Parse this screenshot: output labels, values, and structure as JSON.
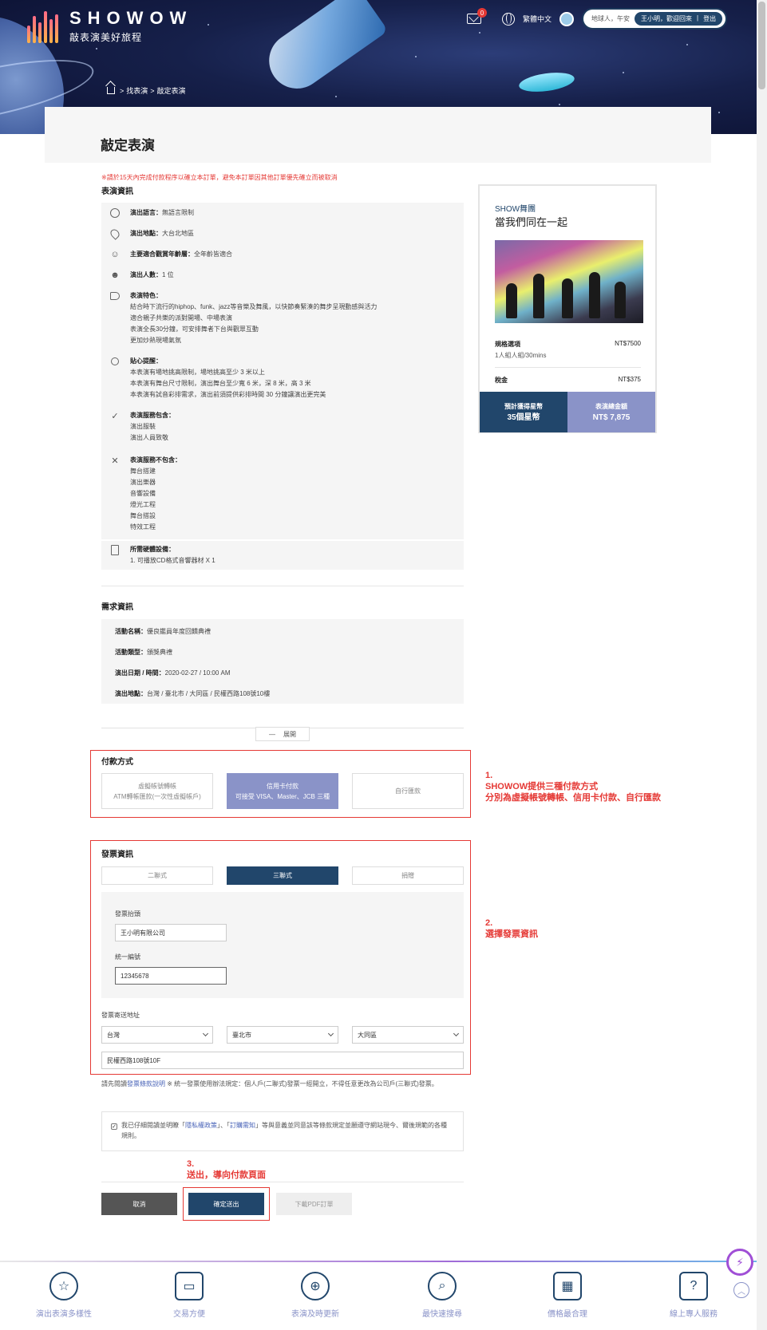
{
  "header": {
    "brand": "SHOWOW",
    "slogan": "敲表演美好旅程",
    "mail_count": "0",
    "language": "繁體中文",
    "greeting": "地球人，午安",
    "user_name": "王小明",
    "welcome": "，歡迎回來",
    "logout": "登出",
    "breadcrumb": [
      "找表演",
      "敲定表演"
    ]
  },
  "page": {
    "title": "敲定表演"
  },
  "notice": "※請於15天內完成付款程序以確立本訂單，避免本訂單因其他訂單優先確立而被取消",
  "show_info": {
    "title": "表演資訊",
    "rows": [
      {
        "icon": "globe-icon",
        "label": "演出語言：",
        "lines": [
          "無語言限制"
        ]
      },
      {
        "icon": "location-pin-icon",
        "label": "演出地點：",
        "lines": [
          "大台北地區"
        ]
      },
      {
        "icon": "audience-icon",
        "label": "主要適合觀賞年齡層：",
        "lines": [
          "全年齡皆適合"
        ]
      },
      {
        "icon": "performers-icon",
        "label": "演出人數：",
        "lines": [
          "1 位"
        ]
      },
      {
        "icon": "tag-icon",
        "label": "表演特色：",
        "lines": [
          "結合時下流行的hiphop、funk、jazz等音樂及舞風，以快節奏緊湊的舞步呈現動感與活力",
          "適合親子共樂的派對開場、中場表演",
          "表演全長30分鐘，可安排舞者下台與觀眾互動",
          "更加炒熱現場氣氛"
        ]
      },
      {
        "icon": "bulb-icon",
        "label": "貼心提醒：",
        "lines": [
          "本表演有場地挑高限制，場地挑高至少 3 米以上",
          "本表演有舞台尺寸限制，演出舞台至少寬 6 米，深 8 米，高 3 米",
          "本表演有試音彩排需求，演出前須提供彩排時間 30 分鐘讓演出更完美"
        ]
      },
      {
        "icon": "check-icon",
        "label": "表演服務包含：",
        "lines": [
          "演出服裝",
          "演出人員致敬"
        ]
      },
      {
        "icon": "cross-icon",
        "label": "表演服務不包含：",
        "lines": [
          "舞台搭建",
          "演出樂器",
          "音響設備",
          "燈光工程",
          "舞台搭設",
          "特效工程"
        ]
      },
      {
        "icon": "speaker-icon",
        "label": "所需硬體設備：",
        "lines": [
          "1. 可播放CD格式音響器材 X 1"
        ]
      }
    ]
  },
  "request_info": {
    "title": "需求資訊",
    "rows": [
      {
        "label": "活動名稱：",
        "value": "優良鑑員年度回饋典禮"
      },
      {
        "label": "活動類型：",
        "value": "頒獎典禮"
      },
      {
        "label": "演出日期 / 時間：",
        "value": "2020-02-27 / 10:00 AM"
      },
      {
        "label": "演出地點：",
        "value": "台灣 / 臺北市 / 大同區 / 民權西路108號10樓"
      }
    ],
    "expand_label": "展開"
  },
  "payment": {
    "title": "付款方式",
    "options": [
      {
        "line1": "虛擬帳號轉帳",
        "line2": "ATM轉帳匯款(一次性虛擬帳戶)"
      },
      {
        "line1": "信用卡付款",
        "line2": "可接受 VISA、Master、JCB 三種"
      },
      {
        "line1": "自行匯款",
        "line2": ""
      }
    ],
    "selected": 1
  },
  "invoice": {
    "title": "發票資訊",
    "types": [
      "二聯式",
      "三聯式",
      "捐贈"
    ],
    "selected": 1,
    "header_label": "發票抬頭",
    "header_value": "王小明有限公司",
    "tax_id_label": "統一編號",
    "tax_id_value": "12345678",
    "address_label": "發票寄送地址",
    "country": "台灣",
    "city": "臺北市",
    "district": "大同區",
    "street": "民權西路108號10F"
  },
  "invoice_note": {
    "prefix": "請先閱讀",
    "link": "發票條款說明",
    "rest": "※ 統一發票使用辦法規定：個人戶(二聯式)發票一經開立，不得任意更改為公司戶(三聯式)發票。"
  },
  "agreement": {
    "text1": "我已仔細閱讀並明瞭「",
    "privacy": "隱私權政策",
    "text2": "」、「",
    "terms": "訂購需知",
    "text3": "」等與意義並同意該等條款規定並願遵守網站現今、爾後規範的各種規則。",
    "checked": true
  },
  "buttons": {
    "cancel": "取消",
    "submit": "確定送出",
    "pdf": "下載PDF訂單"
  },
  "annotations": {
    "a1": [
      "1.",
      "SHOWOW提供三種付款方式",
      "分別為虛擬帳號轉帳、信用卡付款、自行匯款"
    ],
    "a2": [
      "2.",
      "選擇發票資訊"
    ],
    "a3": [
      "3.",
      "送出，導向付款頁面"
    ]
  },
  "summary_card": {
    "subtitle": "SHOW舞團",
    "title": "當我們同在一起",
    "plan_label": "規格選項",
    "plan_price": "NT$7500",
    "plan_desc": "1人組人組/30mins",
    "tax_label": "稅金",
    "tax_value": "NT$375",
    "points_label": "預計獲得星幣",
    "points_value": "35個星幣",
    "total_label": "表演總金額",
    "total_value": "NT$ 7,875"
  },
  "footer": {
    "items": [
      {
        "icon": "star-icon",
        "label": "演出表演多樣性"
      },
      {
        "icon": "card-icon",
        "label": "交易方便"
      },
      {
        "icon": "globe-mouse-icon",
        "label": "表演及時更新"
      },
      {
        "icon": "search-icon",
        "label": "最快速搜尋"
      },
      {
        "icon": "calculator-icon",
        "label": "價格最合理"
      },
      {
        "icon": "chat-icon",
        "label": "線上專人服務"
      }
    ]
  },
  "colors": {
    "accent": "#21466b",
    "accent_light": "#8a93c8",
    "alert": "#e53935"
  }
}
